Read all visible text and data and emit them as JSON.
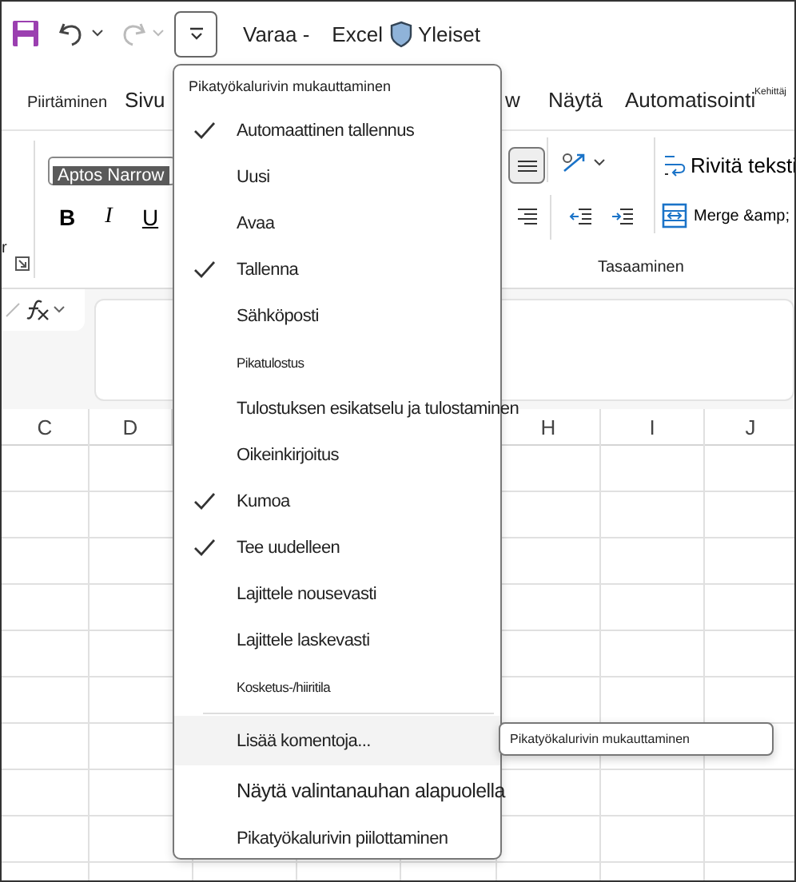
{
  "title_bar": {
    "breadcrumb": "Varaa -",
    "app": "Excel",
    "sensitivity": "Yleiset"
  },
  "tabs": [
    {
      "label": "Piirtäminen",
      "kind": "normal"
    },
    {
      "label": "Sivu",
      "kind": "normal"
    },
    {
      "label": "w",
      "kind": "normal"
    },
    {
      "label": "Näytä",
      "kind": "normal"
    },
    {
      "label": "Automatisointi",
      "kind": "normal"
    },
    {
      "label": "Kehittäj",
      "kind": "tiny"
    }
  ],
  "ribbon": {
    "group_label_tail": "r",
    "font_field": {
      "value": "Aptos Narrow",
      "text_selected": true
    },
    "format_buttons": [
      "B",
      "I",
      "U"
    ],
    "align_buttons": [
      {
        "kind": "middle",
        "selected": true
      },
      {
        "kind": "right",
        "selected": false
      },
      {
        "kind": "outdent",
        "selected": false
      },
      {
        "kind": "indent",
        "selected": false
      }
    ],
    "wrap_text": "Rivitä teksti",
    "merge": "Merge &amp;",
    "group_label": "Tasaaminen"
  },
  "columns": [
    {
      "label": "C"
    },
    {
      "label": "D"
    },
    {
      "label": "H"
    },
    {
      "label": "I"
    },
    {
      "label": "J"
    }
  ],
  "menu": {
    "header": "Pikatyökalurivin mukauttaminen",
    "items": [
      {
        "label": "Automaattinen tallennus",
        "kind": "normal",
        "checked": true,
        "selected": false
      },
      {
        "label": "Uusi",
        "kind": "normal",
        "checked": false,
        "selected": false
      },
      {
        "label": "Avaa",
        "kind": "normal",
        "checked": false,
        "selected": false
      },
      {
        "label": "Tallenna",
        "kind": "normal",
        "checked": true,
        "selected": false
      },
      {
        "label": "Sähköposti",
        "kind": "normal",
        "checked": false,
        "selected": false
      },
      {
        "label": "Pikatulostus",
        "kind": "small",
        "checked": false,
        "selected": false
      },
      {
        "label": "Tulostuksen esikatselu ja tulostaminen",
        "kind": "normal",
        "checked": false,
        "selected": false
      },
      {
        "label": "Oikeinkirjoitus",
        "kind": "normal",
        "checked": false,
        "selected": false
      },
      {
        "label": "Kumoa",
        "kind": "normal",
        "checked": true,
        "selected": false
      },
      {
        "label": "Tee uudelleen",
        "kind": "normal",
        "checked": true,
        "selected": false
      },
      {
        "label": "Lajittele nousevasti",
        "kind": "normal",
        "checked": false,
        "selected": false
      },
      {
        "label": "Lajittele laskevasti",
        "kind": "normal",
        "checked": false,
        "selected": false
      },
      {
        "label": "Kosketus-/hiiritila",
        "kind": "small",
        "checked": false,
        "selected": false
      },
      {
        "label": "Lisää komentoja...",
        "kind": "separated",
        "checked": false,
        "selected": true
      },
      {
        "label": "Näytä valintanauhan alapuolella",
        "kind": "large",
        "checked": false,
        "selected": false
      },
      {
        "label": "Pikatyökalurivin piilottaminen",
        "kind": "normal",
        "checked": false,
        "selected": false
      }
    ]
  },
  "tooltip": "Pikatyökalurivin mukauttaminen"
}
